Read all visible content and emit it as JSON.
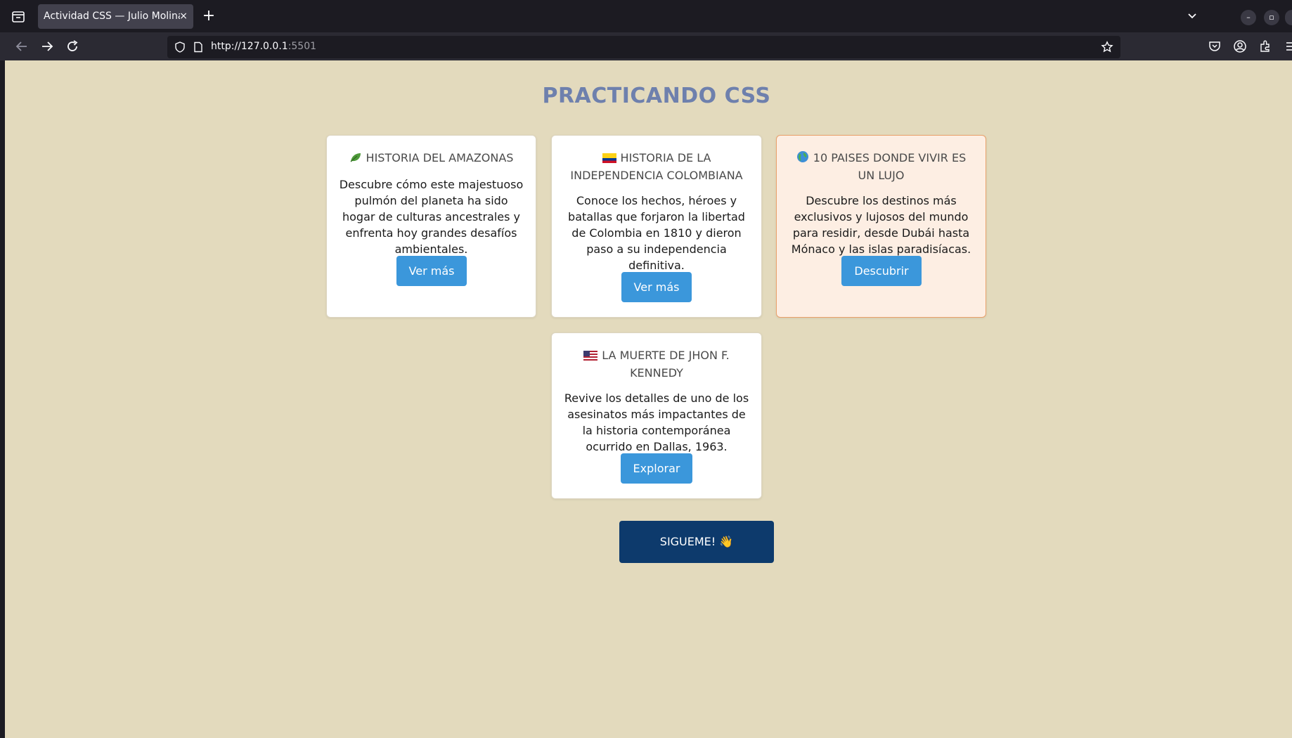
{
  "browser": {
    "tab_title": "Actividad CSS — Julio Molina",
    "tab_close": "×",
    "new_tab": "+",
    "url_host": "http://127.0.0.1",
    "url_port": ":5501"
  },
  "page": {
    "title": "PRACTICANDO CSS",
    "cards": [
      {
        "title": "HISTORIA DEL AMAZONAS",
        "icon": "leaf-icon",
        "text": "Descubre cómo este majestuoso pulmón del planeta ha sido hogar de culturas ancestrales y enfrenta hoy grandes desafíos ambientales.",
        "button": "Ver más"
      },
      {
        "title": "HISTORIA DE LA INDEPENDENCIA COLOMBIANA",
        "icon": "colombia-flag-icon",
        "text": "Conoce los hechos, héroes y batallas que forjaron la libertad de Colombia en 1810 y dieron paso a su independencia definitiva.",
        "button": "Ver más"
      },
      {
        "title": "10 PAISES DONDE VIVIR ES UN LUJO",
        "icon": "globe-icon",
        "text": "Descubre los destinos más exclusivos y lujosos del mundo para residir, desde Dubái hasta Mónaco y las islas paradisíacas.",
        "button": "Descubrir"
      },
      {
        "title": "LA MUERTE DE JHON F. KENNEDY",
        "icon": "usa-flag-icon",
        "text": "Revive los detalles de uno de los asesinatos más impactantes de la historia contemporánea ocurrido en Dallas, 1963.",
        "button": "Explorar"
      }
    ],
    "follow_button": "SIGUEME! 👋"
  },
  "colors": {
    "page_bg": "#e3dabd",
    "title": "#6e80ad",
    "button": "#3b97db",
    "follow_button": "#0d3a6c",
    "featured_card_bg": "#fdeee3",
    "featured_card_border": "#e9a06a"
  }
}
